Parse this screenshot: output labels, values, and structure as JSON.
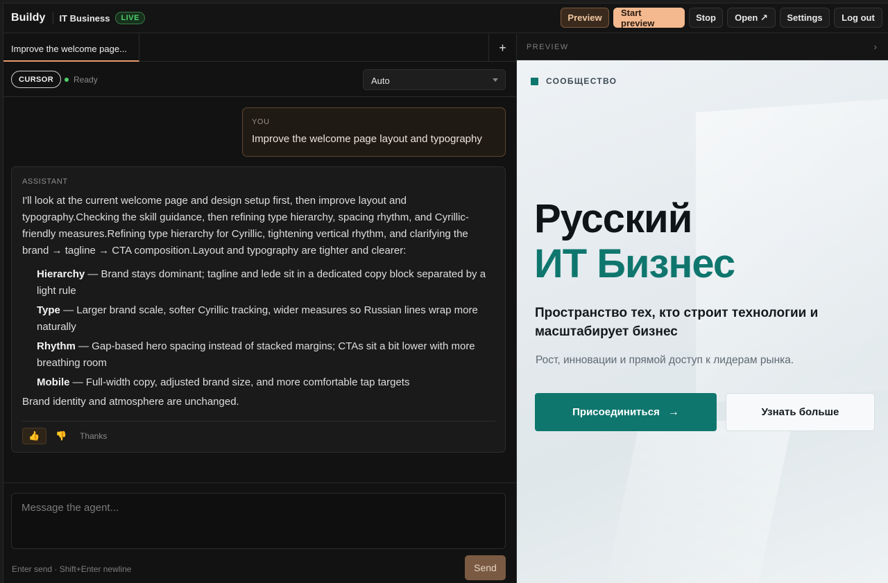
{
  "topbar": {
    "logo": "Buildy",
    "project": "IT Business",
    "status_badge": "LIVE",
    "buttons": {
      "preview": "Preview",
      "start_preview": "Start preview",
      "stop": "Stop",
      "open": "Open ↗",
      "settings": "Settings",
      "logout": "Log out"
    }
  },
  "tabs": {
    "active": "Improve the welcome page...",
    "add": "+"
  },
  "toolbar": {
    "agent": "CURSOR",
    "status": "Ready",
    "model_select": "Auto"
  },
  "messages": {
    "user": {
      "role": "YOU",
      "text": "Improve the welcome page layout and typography"
    },
    "assistant": {
      "role": "ASSISTANT",
      "intro": "I'll look at the current welcome page and design setup first, then improve layout and typography.Checking the skill guidance, then refining type hierarchy, spacing rhythm, and Cyrillic-friendly measures.Refining type hierarchy for Cyrillic, tightening vertical rhythm, and clarifying the brand → tagline → CTA composition.Layout and typography are tighter and clearer:",
      "bullets": [
        {
          "title": "Hierarchy",
          "text": " — Brand stays dominant; tagline and lede sit in a dedicated copy block separated by a light rule"
        },
        {
          "title": "Type",
          "text": " — Larger brand scale, softer Cyrillic tracking, wider measures so Russian lines wrap more naturally"
        },
        {
          "title": "Rhythm",
          "text": " — Gap-based hero spacing instead of stacked margins; CTAs sit a bit lower with more breathing room"
        },
        {
          "title": "Mobile",
          "text": " — Full-width copy, adjusted brand size, and more comfortable tap targets"
        }
      ],
      "outro": "Brand identity and atmosphere are unchanged.",
      "feedback_label": "Thanks"
    }
  },
  "composer": {
    "placeholder": "Message the agent...",
    "hint": "Enter send · Shift+Enter newline",
    "send": "Send"
  },
  "preview": {
    "header": "PREVIEW",
    "eyebrow": "СООБЩЕСТВО",
    "title_line1": "Русский",
    "title_line2": "ИТ Бизнес",
    "tagline": "Пространство тех, кто строит технологии и масштабирует бизнес",
    "lede": "Рост, инновации и прямой доступ к лидерам рынка.",
    "cta_primary": "Присоединиться",
    "cta_secondary": "Узнать больше"
  },
  "colors": {
    "accent": "#f4b98f",
    "brand_teal": "#0f766e",
    "live_green": "#4fcf6a"
  }
}
